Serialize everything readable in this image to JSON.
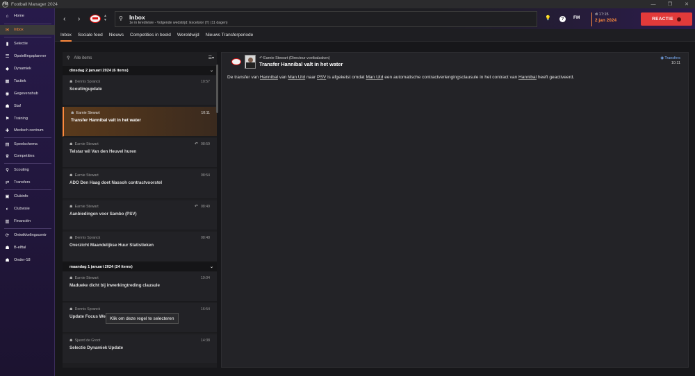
{
  "window": {
    "title": "Football Manager 2024",
    "logo": "FM"
  },
  "header": {
    "title": "Inbox",
    "subtitle": "1e in Eredivisie - Volgende wedstrijd: Excelsior (T) (11 dagen)",
    "time": "di 17:15",
    "date": "2 jan 2024",
    "fm_label": "FM",
    "reactie_label": "REACTIE"
  },
  "sidebar": {
    "items": [
      {
        "label": "Home",
        "icon": "home-icon",
        "glyph": "⌂"
      },
      {
        "label": "Inbox",
        "icon": "inbox-icon",
        "glyph": "✉"
      },
      {
        "label": "Selectie",
        "icon": "squad-icon",
        "glyph": "▮"
      },
      {
        "label": "Opstellingsplanner",
        "icon": "planner-icon",
        "glyph": "☰"
      },
      {
        "label": "Dynamiek",
        "icon": "dynamics-icon",
        "glyph": "◆"
      },
      {
        "label": "Tactiek",
        "icon": "tactics-icon",
        "glyph": "▦"
      },
      {
        "label": "Gegevenshub",
        "icon": "datahub-icon",
        "glyph": "◉"
      },
      {
        "label": "Staf",
        "icon": "staff-icon",
        "glyph": "☗"
      },
      {
        "label": "Training",
        "icon": "training-icon",
        "glyph": "⚑"
      },
      {
        "label": "Medisch centrum",
        "icon": "medical-icon",
        "glyph": "✚"
      },
      {
        "label": "Speelschema",
        "icon": "schedule-icon",
        "glyph": "▤"
      },
      {
        "label": "Competities",
        "icon": "trophy-icon",
        "glyph": "♛"
      },
      {
        "label": "Scouting",
        "icon": "scouting-icon",
        "glyph": "⚲"
      },
      {
        "label": "Transfers",
        "icon": "transfers-icon",
        "glyph": "⇄"
      },
      {
        "label": "Clubinfo",
        "icon": "clubinfo-icon",
        "glyph": "▣"
      },
      {
        "label": "Clubvisie",
        "icon": "clubvision-icon",
        "glyph": "◐"
      },
      {
        "label": "Financiën",
        "icon": "finances-icon",
        "glyph": "▥"
      },
      {
        "label": "Ontwikkelingscentr",
        "icon": "development-icon",
        "glyph": "⟳"
      },
      {
        "label": "B-elftal",
        "icon": "reserve-team-icon",
        "glyph": "☗"
      },
      {
        "label": "Onder-18",
        "icon": "u18-icon",
        "glyph": "☗"
      }
    ]
  },
  "tabs": [
    "Inbox",
    "Sociale feed",
    "Nieuws",
    "Competities in beeld",
    "Wereldwijd",
    "Nieuws Transferperiode"
  ],
  "inbox": {
    "search_placeholder": "Alle items",
    "groups": [
      {
        "label": "dinsdag 2 januari 2024 (6 items)"
      },
      {
        "label": "maandag 1 januari 2024 (24 items)"
      }
    ],
    "items": [
      {
        "from": "Dennis Spranck",
        "time": "10:57",
        "subject": "Scoutingupdate"
      },
      {
        "from": "Earnie Stewart",
        "time": "10:11",
        "subject": "Transfer Hannibal valt in het water"
      },
      {
        "from": "Earnie Stewart",
        "time": "08:59",
        "subject": "Telstar wil Van den Heuvel huren"
      },
      {
        "from": "Earnie Stewart",
        "time": "08:54",
        "subject": "ADO Den Haag doet Nassoh contractvoorstel"
      },
      {
        "from": "Earnie Stewart",
        "time": "08:49",
        "subject": "Aanbiedingen voor Sambo (PSV)"
      },
      {
        "from": "Dennis Spranck",
        "time": "08:48",
        "subject": "Overzicht Maandelijkse Huur Statistieken"
      },
      {
        "from": "Earnie Stewart",
        "time": "19:04",
        "subject": "Madueke dicht bij inwerkingtreding clausule"
      },
      {
        "from": "Dennis Spranck",
        "time": "16:54",
        "subject": "Update Focus We"
      },
      {
        "from": "Sjaord de Groot",
        "time": "14:38",
        "subject": "Selectie Dynamiek Update"
      }
    ],
    "tooltip": "Klik om deze regel te selecteren"
  },
  "message": {
    "from": "Earnie Stewart  (Directeur voetbalzaken)",
    "subject": "Transfer Hannibal valt in het water",
    "category": "Transfers",
    "time": "10:11",
    "body": {
      "p1": "De transfer van ",
      "player1": "Hannibal",
      "p2": " van ",
      "club1": "Man Utd",
      "p3": " naar ",
      "club2": "PSV",
      "p4": " is afgeketst omdat ",
      "club3": "Man Utd",
      "p5": " een automatische contractverlengingsclausule in het contract van ",
      "player2": "Hannibal",
      "p6": " heeft geactiveerd."
    }
  }
}
